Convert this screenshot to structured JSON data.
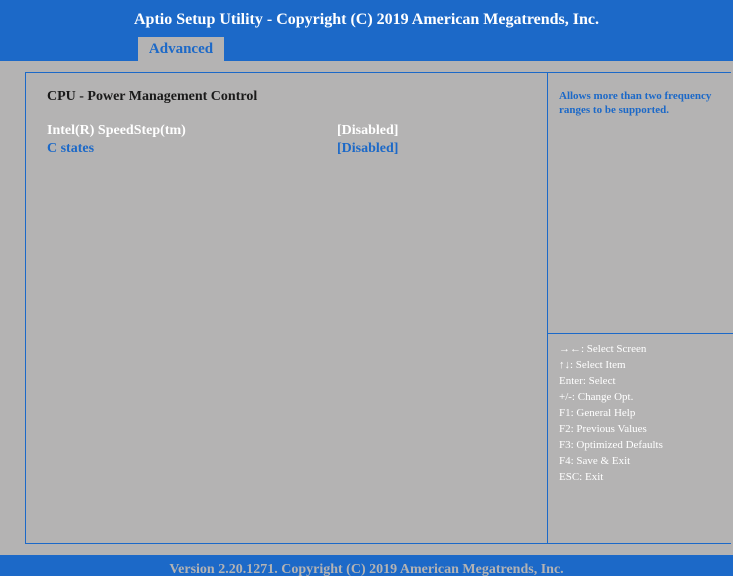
{
  "header": {
    "title": "Aptio Setup Utility - Copyright (C) 2019 American Megatrends, Inc."
  },
  "tabs": [
    {
      "label": "Advanced",
      "active": true
    }
  ],
  "main": {
    "section_title": "CPU - Power Management Control",
    "settings": [
      {
        "label": "Intel(R) SpeedStep(tm)",
        "value": "[Disabled]",
        "selected": false
      },
      {
        "label": "C states",
        "value": "[Disabled]",
        "selected": true
      }
    ]
  },
  "help": {
    "line1": "Allows more than two frequency",
    "line2": "ranges to be supported."
  },
  "keys": [
    "→←: Select Screen",
    "↑↓: Select Item",
    "Enter: Select",
    "+/-: Change Opt.",
    "F1: General Help",
    "F2: Previous Values",
    "F3: Optimized Defaults",
    "F4: Save & Exit",
    "ESC: Exit"
  ],
  "footer": {
    "text": "Version 2.20.1271. Copyright (C) 2019 American Megatrends, Inc."
  },
  "colors": {
    "blue": "#1c69c8",
    "gray": "#b4b3b3",
    "white": "#ffffff"
  }
}
